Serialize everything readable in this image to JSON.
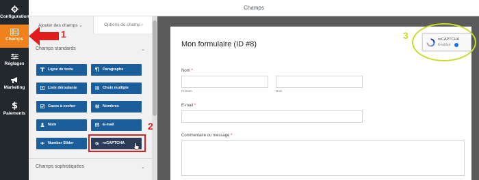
{
  "sidebar": {
    "items": [
      {
        "label": "Configuration",
        "icon": "gear-icon"
      },
      {
        "label": "Champs",
        "icon": "table-icon"
      },
      {
        "label": "Réglages",
        "icon": "sliders-icon"
      },
      {
        "label": "Marketing",
        "icon": "megaphone-icon"
      },
      {
        "label": "Paiements",
        "icon": "dollar-icon"
      }
    ],
    "active_color": "#f0821e",
    "bg_color": "#23282d"
  },
  "header": {
    "title": "Champs"
  },
  "fields_panel": {
    "tabs": [
      {
        "label": "Ajouter des champs",
        "suffix": "⌄"
      },
      {
        "label": "Options du champ",
        "suffix": "›"
      }
    ],
    "standard_section": {
      "title": "Champs standards"
    },
    "buttons": [
      {
        "label": "Ligne de texte",
        "icon": "text-line-icon"
      },
      {
        "label": "Paragraphe",
        "icon": "paragraph-icon"
      },
      {
        "label": "Liste déroulante",
        "icon": "dropdown-icon"
      },
      {
        "label": "Choix multiple",
        "icon": "multiple-choice-icon"
      },
      {
        "label": "Cases à cocher",
        "icon": "checkbox-icon"
      },
      {
        "label": "Nombres",
        "icon": "hash-icon"
      },
      {
        "label": "Nom",
        "icon": "user-icon"
      },
      {
        "label": "E-mail",
        "icon": "envelope-icon"
      },
      {
        "label": "Number Slider",
        "icon": "slider-icon"
      },
      {
        "label": "reCAPTCHA",
        "icon": "google-icon"
      }
    ],
    "fancy_section": {
      "title": "Champs sophistiquées"
    },
    "button_color": "#1a5f9b"
  },
  "form": {
    "title": "Mon formulaire (ID #8)",
    "name_label": "Nom",
    "first_sublabel": "Prénom",
    "last_sublabel": "Nom",
    "email_label": "E-mail",
    "comment_label": "Commentaire ou message",
    "required_mark": "*"
  },
  "recaptcha_badge": {
    "title": "reCAPTCHA",
    "status": "Enabled"
  },
  "annotations": {
    "n1": "1",
    "n2": "2",
    "n3": "3",
    "red": "#e01e1e",
    "green": "#c8dc28"
  }
}
